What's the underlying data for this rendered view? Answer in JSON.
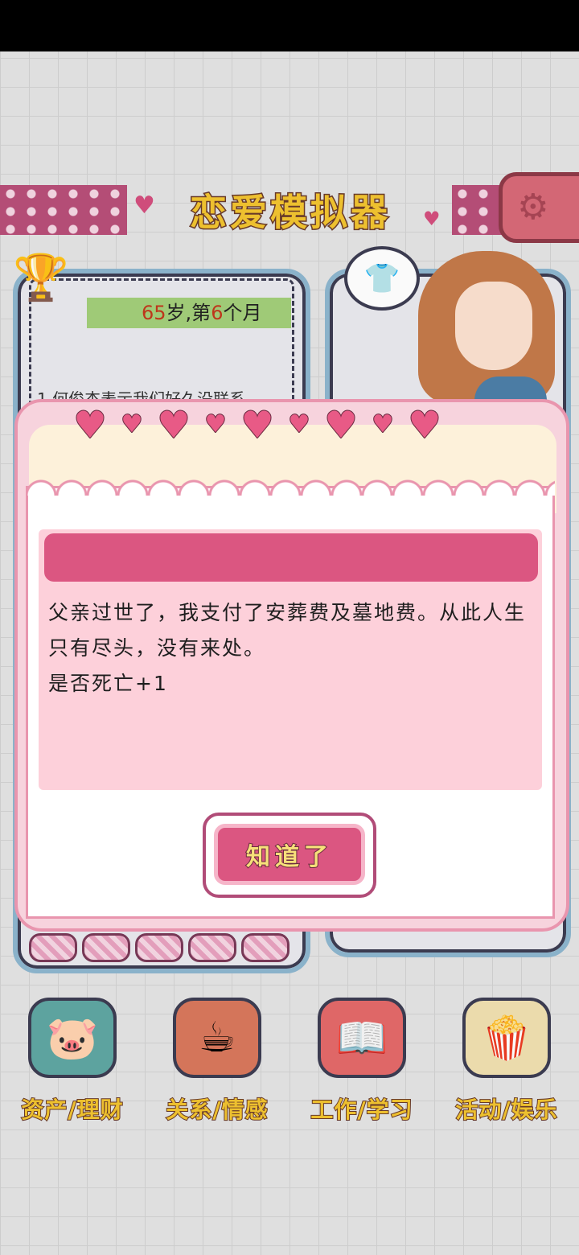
{
  "app": {
    "title": "恋爱模拟器",
    "settings_icon": "gear-icon"
  },
  "status": {
    "age_prefix": "65",
    "age_unit": "岁,第",
    "month": "6",
    "month_unit": "个月"
  },
  "events": {
    "peek_text": "1.何俊杰表示我们好久没联系"
  },
  "nav": {
    "items": [
      {
        "label": "资产/理财",
        "icon": "piggy-bank-icon"
      },
      {
        "label": "关系/情感",
        "icon": "cups-icon"
      },
      {
        "label": "工作/学习",
        "icon": "notebook-icon"
      },
      {
        "label": "活动/娱乐",
        "icon": "popcorn-icon"
      }
    ]
  },
  "dialog": {
    "header_text": "",
    "message": "父亲过世了，我支付了安葬费及墓地费。从此人生只有尽头，没有来处。\n是否死亡+1",
    "confirm_label": "知道了"
  },
  "colors": {
    "accent_pink": "#db5681",
    "title_yellow": "#f2c430",
    "panel_border": "#8db6cf"
  }
}
